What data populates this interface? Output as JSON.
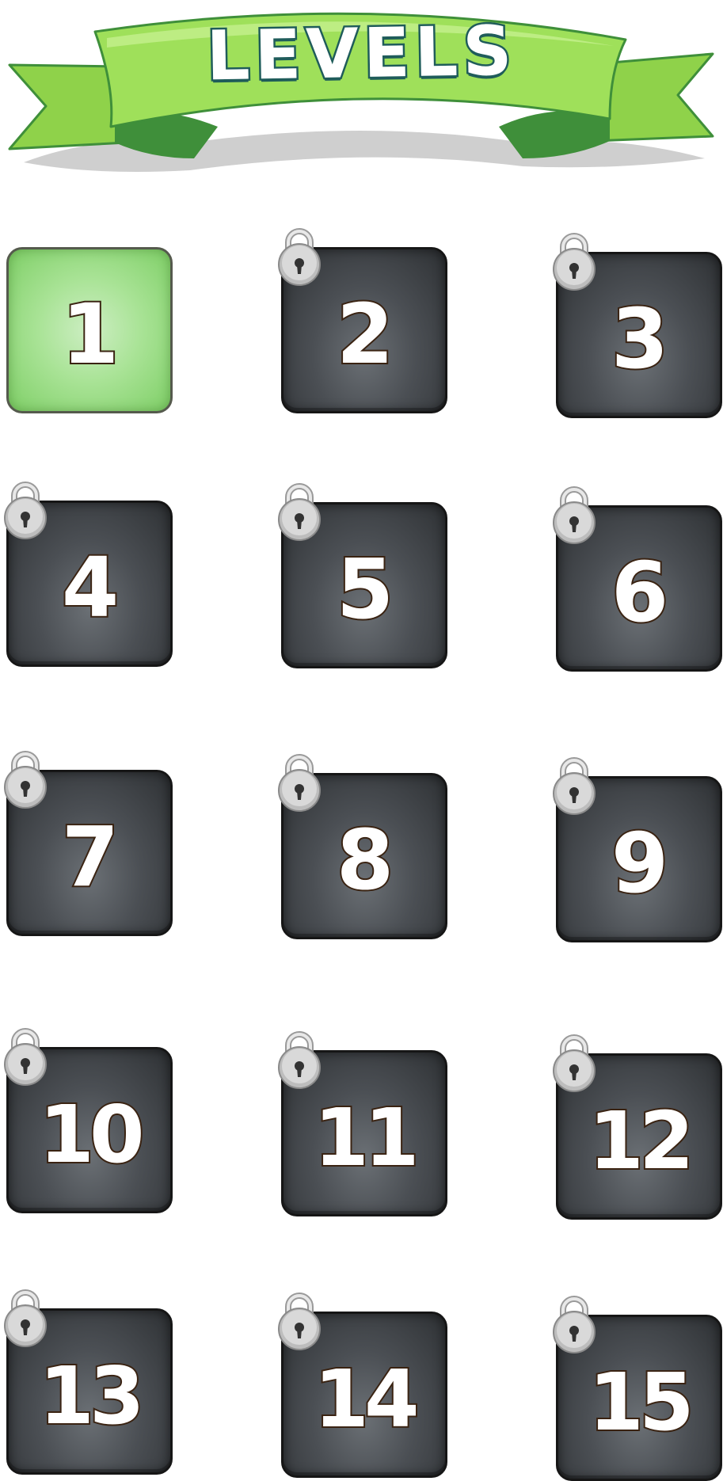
{
  "screen": {
    "title": "LEVELS"
  },
  "colors": {
    "banner_green": "#9fe05a",
    "banner_dark_green": "#3f8f3a",
    "title_outline": "#1f5c5a",
    "tile_locked": "#4b4f54",
    "tile_unlocked": "#a9e396",
    "number_outline": "#3a2312"
  },
  "levels": [
    {
      "number": "1",
      "locked": false,
      "icon": null
    },
    {
      "number": "2",
      "locked": true,
      "icon": "padlock-icon"
    },
    {
      "number": "3",
      "locked": true,
      "icon": "padlock-icon"
    },
    {
      "number": "4",
      "locked": true,
      "icon": "padlock-icon"
    },
    {
      "number": "5",
      "locked": true,
      "icon": "padlock-icon"
    },
    {
      "number": "6",
      "locked": true,
      "icon": "padlock-icon"
    },
    {
      "number": "7",
      "locked": true,
      "icon": "padlock-icon"
    },
    {
      "number": "8",
      "locked": true,
      "icon": "padlock-icon"
    },
    {
      "number": "9",
      "locked": true,
      "icon": "padlock-icon"
    },
    {
      "number": "10",
      "locked": true,
      "icon": "padlock-icon"
    },
    {
      "number": "11",
      "locked": true,
      "icon": "padlock-icon"
    },
    {
      "number": "12",
      "locked": true,
      "icon": "padlock-icon"
    },
    {
      "number": "13",
      "locked": true,
      "icon": "padlock-icon"
    },
    {
      "number": "14",
      "locked": true,
      "icon": "padlock-icon"
    },
    {
      "number": "15",
      "locked": true,
      "icon": "padlock-icon"
    }
  ]
}
